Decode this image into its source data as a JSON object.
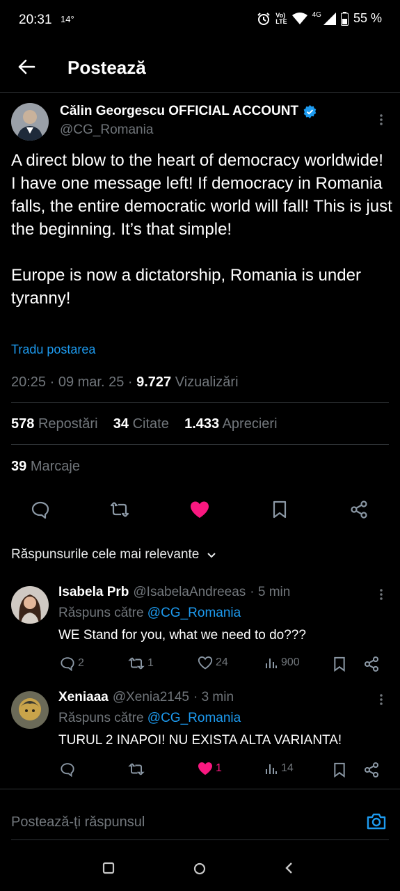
{
  "status_bar": {
    "time": "20:31",
    "temp": "14°",
    "battery": "55 %",
    "net": "4G"
  },
  "header": {
    "title": "Postează"
  },
  "tweet": {
    "author_name": "Călin Georgescu OFFICIAL ACCOUNT",
    "handle": "@CG_Romania",
    "text": "A direct blow to the heart of democracy worldwide! I have one message left! If democracy in Romania falls, the entire democratic world will fall! This is just the beginning. It’s that simple!\n\nEurope is now a dictatorship, Romania is under tyranny!",
    "translate_label": "Tradu postarea",
    "time": "20:25 · 09 mar. 25 · ",
    "views": "9.727",
    "views_label": "Vizualizări",
    "reposts": "578",
    "reposts_label": "Repostări",
    "quotes": "34",
    "quotes_label": "Citate",
    "likes": "1.433",
    "likes_label": "Aprecieri",
    "bookmarks": "39",
    "bookmarks_label": "Marcaje"
  },
  "sort_label": "Răspunsurile cele mai relevante",
  "replies": [
    {
      "name": "Isabela Prb",
      "handle": "@IsabelaAndreeas",
      "time": "· 5 min",
      "reply_to_prefix": "Răspuns către",
      "reply_to_handle": "@CG_Romania",
      "text": "WE Stand for you, what we need to do???",
      "replies": "2",
      "reposts": "1",
      "likes": "24",
      "views": "900"
    },
    {
      "name": "Xeniaaa",
      "handle": "@Xenia2145",
      "time": "· 3 min",
      "reply_to_prefix": "Răspuns către",
      "reply_to_handle": "@CG_Romania",
      "text": "TURUL 2 INAPOI! NU EXISTA ALTA VARIANTA!",
      "replies": "",
      "reposts": "",
      "likes": "1",
      "views": "14"
    }
  ],
  "compose_placeholder": "Postează-ți răspunsul",
  "colors": {
    "accent": "#1d9bf0",
    "like": "#f91880",
    "muted": "#71767b"
  }
}
